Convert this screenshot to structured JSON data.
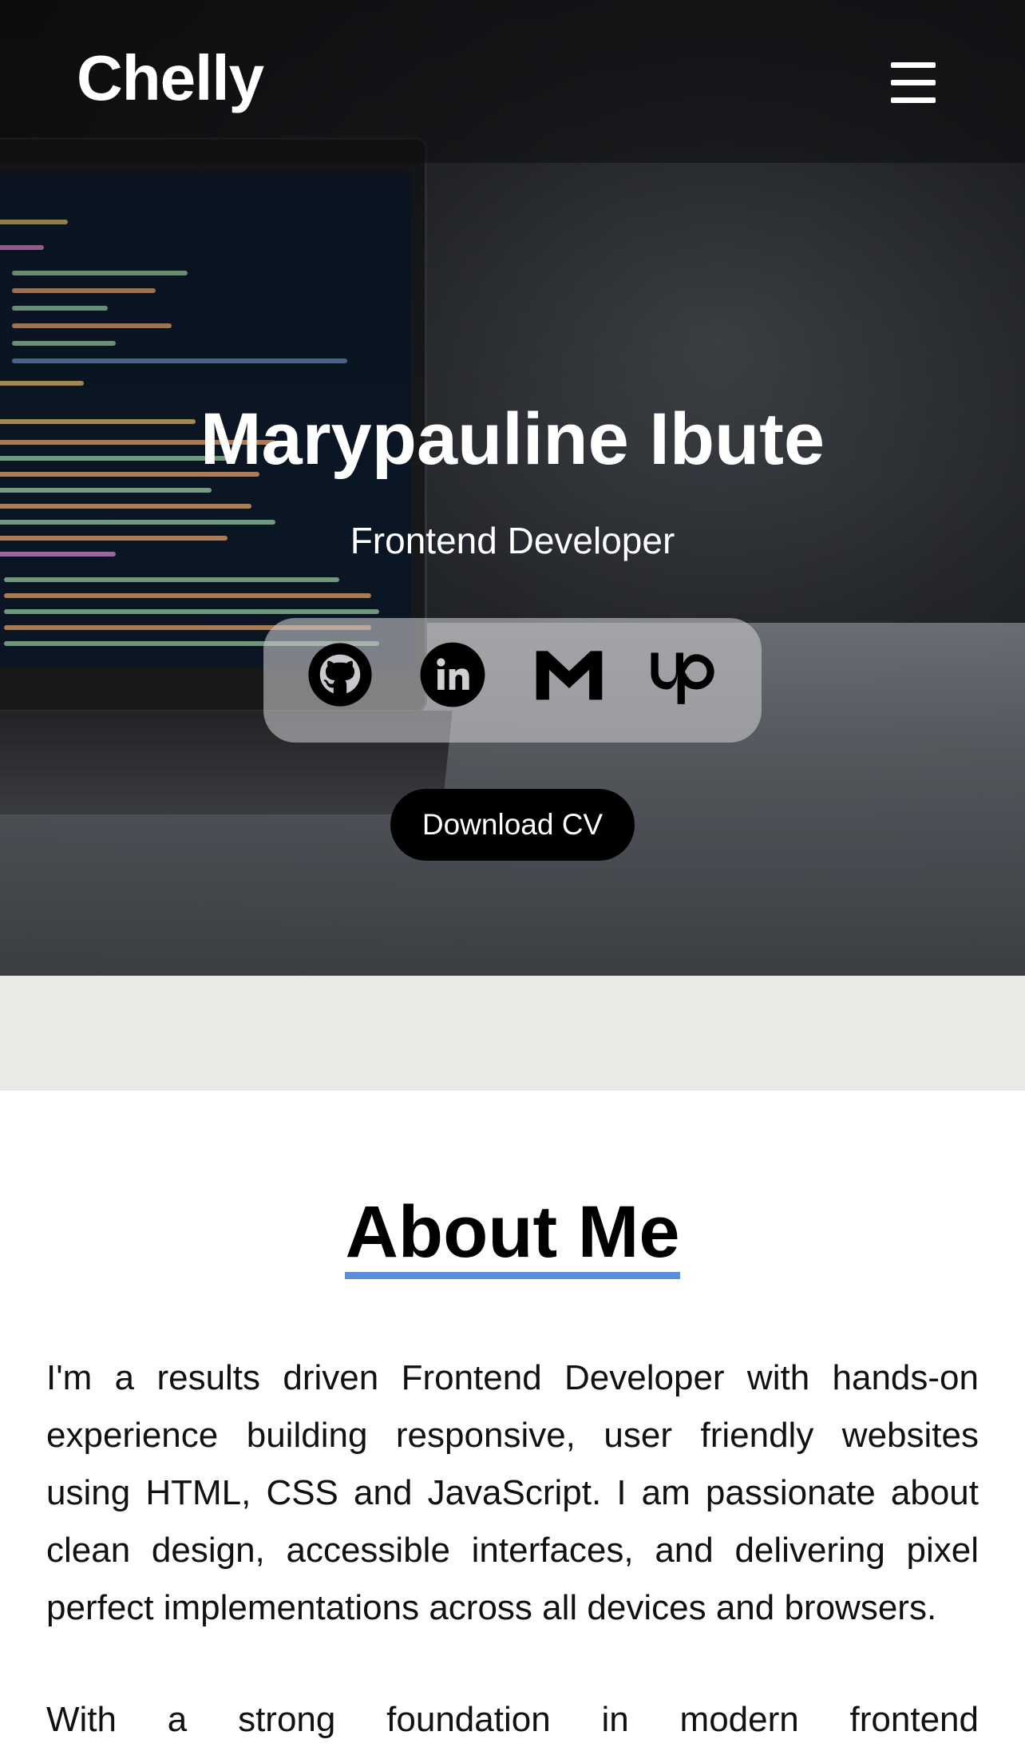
{
  "header": {
    "logo": "Chelly",
    "menu_icon": "hamburger-menu-icon"
  },
  "hero": {
    "name": "Marypauline Ibute",
    "role": "Frontend Developer",
    "social": [
      {
        "icon": "github-icon"
      },
      {
        "icon": "linkedin-icon"
      },
      {
        "icon": "gmail-icon"
      },
      {
        "icon": "upwork-icon"
      }
    ],
    "cv_button": "Download CV"
  },
  "about": {
    "title": "About Me",
    "paragraph_1": "I'm a results driven Frontend Developer with hands-on experience building responsive, user friendly websites using HTML, CSS and JavaScript. I am passionate about clean design, accessible interfaces, and delivering pixel perfect implementations across all devices and browsers.",
    "paragraph_2": "With a strong foundation in modern frontend"
  },
  "colors": {
    "accent_underline": "#5a8ee0",
    "band": "#e9e9e6",
    "button": "#000000"
  }
}
